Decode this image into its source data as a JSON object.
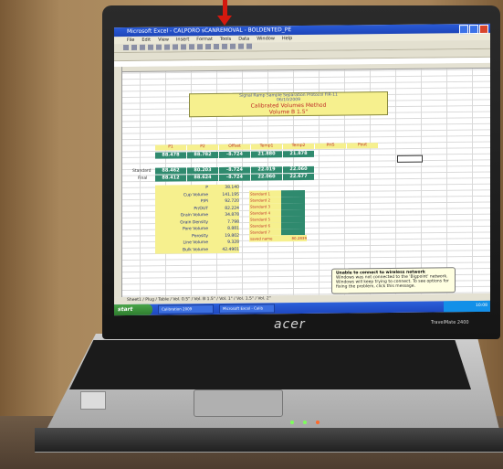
{
  "window": {
    "title": "Microsoft Excel - CALPORO sCANREMOVAL - BOLDENTED_PE",
    "menus": [
      "File",
      "Edit",
      "View",
      "Insert",
      "Format",
      "Tools",
      "Data",
      "Window",
      "Help"
    ]
  },
  "sheet": {
    "header_lines": [
      "Signal Ramp Sample Separation Protocol FIR-11",
      "06/10/2009",
      "Calibrated Volumes Method",
      "Volume B 1.5\""
    ],
    "col_headers": [
      "P1",
      "P2",
      "Offset",
      "Temp1",
      "Temp2",
      "PHS",
      "Pout"
    ],
    "rows": [
      {
        "label": "",
        "values": [
          "88.478",
          "88.782",
          "-8.724",
          "21.880",
          "21.878"
        ]
      },
      {
        "label": "Standard",
        "values": [
          "88.462",
          "80.203",
          "-8.724",
          "22.019",
          "22.060"
        ]
      },
      {
        "label": "Final",
        "values": [
          "88.412",
          "88.624",
          "-8.724",
          "22.060",
          "22.677"
        ]
      }
    ],
    "stats": [
      {
        "k": "P",
        "v": "38.140"
      },
      {
        "k": "Cup Volume",
        "v": "141.195"
      },
      {
        "k": "P/Pi",
        "v": "92.720"
      },
      {
        "k": "Pr/OUT",
        "v": "82.224"
      },
      {
        "k": "Grain Volume",
        "v": "34.878"
      },
      {
        "k": "Grain Density",
        "v": "7.798"
      },
      {
        "k": "Pore Volume",
        "v": "8.881"
      },
      {
        "k": "Porosity",
        "v": "19.802"
      },
      {
        "k": "Line Volume",
        "v": "9.328"
      },
      {
        "k": "Bulk Volume",
        "v": "42.4901"
      }
    ],
    "standards": [
      "Standard 1",
      "Standard 2",
      "Standard 3",
      "Standard 4",
      "Standard 5",
      "Standard 6",
      "Standard 7"
    ],
    "std_summary": "saved name",
    "std_value": "80.2839"
  },
  "sheet_tabs": "Sheet1 / Plug / Table / Vol. 0.5\" / Vol. B 1.5\" / Vol. 1\" / Vol. 1.5\" / Vol. 2\"",
  "taskbar": {
    "start": "start",
    "items": [
      "Calibration 2009",
      "Microsoft Excel - Calib"
    ],
    "clock": "10:08"
  },
  "balloon": {
    "title": "Unable to connect to wireless network",
    "body": "Windows was not connected to the 'Bigpoint' network. Windows will keep trying to connect. To see options for fixing the problem, click this message."
  },
  "laptop": {
    "brand": "acer",
    "model": "TravelMate 2400"
  }
}
